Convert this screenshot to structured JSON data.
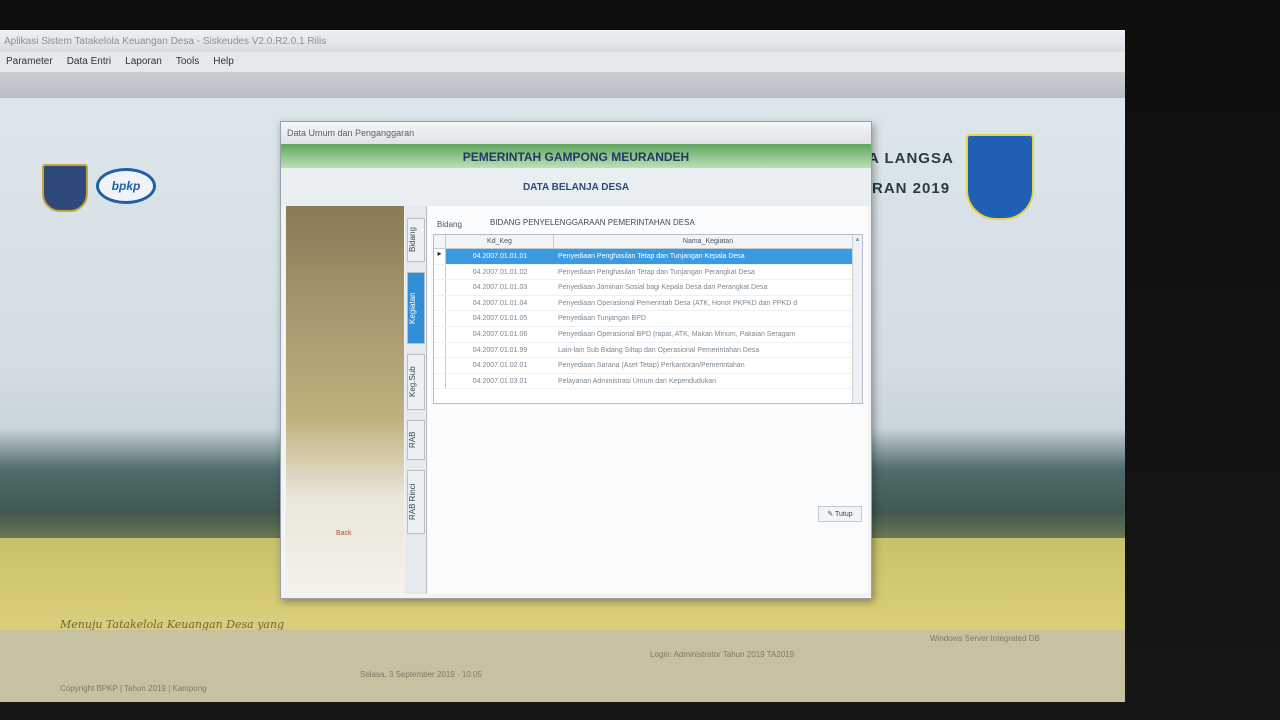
{
  "window": {
    "title": "Aplikasi Sistem Tatakelola Keuangan Desa - Siskeudes V2.0.R2.0.1 Rilis"
  },
  "menu": [
    "Parameter",
    "Data Entri",
    "Laporan",
    "Tools",
    "Help"
  ],
  "desktop": {
    "bpkp_text": "bpkp",
    "headline_right_1": "A LANGSA",
    "headline_right_2": "RAN 2019",
    "tagline": "Menuju Tatakelola Keuangan Desa yang",
    "status_1": "Copyright BPKP | Tahun 2019 | Kampong",
    "status_2": "Selasa, 3 September 2019 - 10:05",
    "status_3": "Login: Administrator  Tahun 2019  TA2019",
    "status_4": "Windows Server Integrated DB"
  },
  "dialog": {
    "title": "Data Umum dan Penganggaran",
    "header": "PEMERINTAH GAMPONG MEURANDEH",
    "subheader": "DATA BELANJA DESA",
    "side_label": "Back",
    "tabs": [
      "Bidang",
      "Kegiatan",
      "Keg.Sub",
      "RAB",
      "RAB Rinci"
    ],
    "active_tab": "Kegiatan",
    "bidang_label": "Bidang",
    "bidang_value": "BIDANG PENYELENGGARAAN PEMERINTAHAN DESA",
    "columns": {
      "kd": "Kd_Keg",
      "nama": "Nama_Kegiatan"
    },
    "rows": [
      {
        "kd": "04.2007.01.01.01",
        "nama": "Penyediaan Penghasilan Tetap dan Tunjangan Kepala Desa",
        "selected": true
      },
      {
        "kd": "04.2007.01.01.02",
        "nama": "Penyediaan Penghasilan Tetap dan Tunjangan Perangkat Desa",
        "selected": false
      },
      {
        "kd": "04.2007.01.01.03",
        "nama": "Penyediaan Jaminan Sosial bagi Kepala Desa dan Perangkat Desa",
        "selected": false
      },
      {
        "kd": "04.2007.01.01.04",
        "nama": "Penyediaan Operasional Pemerintah Desa (ATK, Honor PKPKD dan PPKD d",
        "selected": false
      },
      {
        "kd": "04.2007.01.01.05",
        "nama": "Penyediaan Tunjangan BPD",
        "selected": false
      },
      {
        "kd": "04.2007.01.01.06",
        "nama": "Penyediaan Operasional BPD (rapat, ATK, Makan Minum, Pakaian Seragam",
        "selected": false
      },
      {
        "kd": "04.2007.01.01.99",
        "nama": "Lain-lain Sub Bidang Siltap dan Operasional Pemerintahan Desa",
        "selected": false
      },
      {
        "kd": "04.2007.01.02.01",
        "nama": "Penyediaan Sarana (Aset Tetap) Perkantoran/Pemerintahan",
        "selected": false
      },
      {
        "kd": "04.2007.01.03.01",
        "nama": "Pelayanan Administrasi Umum dan Kependudukan",
        "selected": false
      }
    ],
    "close_button": "Tutup"
  }
}
